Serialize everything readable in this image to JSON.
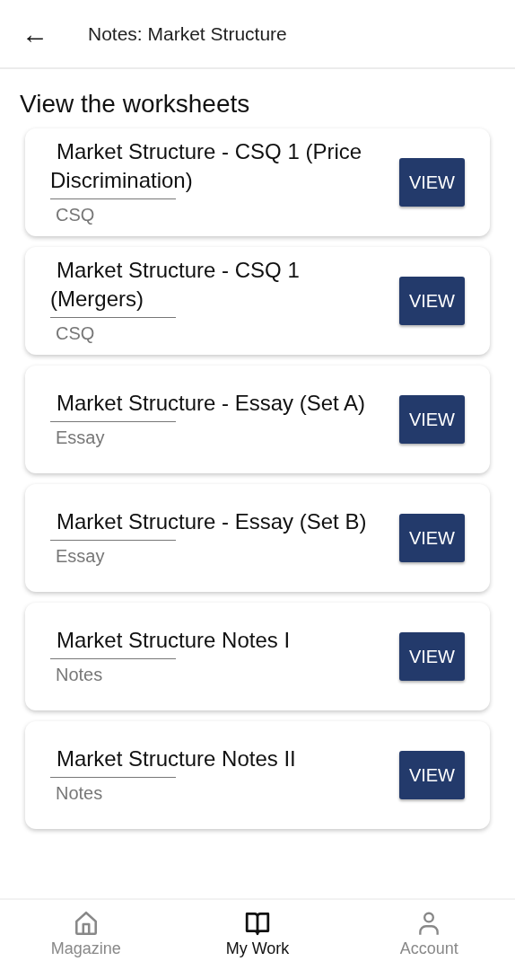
{
  "header": {
    "back": "←",
    "title": "Notes: Market Structure"
  },
  "heading": "View the worksheets",
  "worksheets": [
    {
      "title": "Market Structure - CSQ 1 (Price Discrimination)",
      "type": "CSQ",
      "button": "VIEW"
    },
    {
      "title": "Market Structure - CSQ 1 (Mergers)",
      "type": "CSQ",
      "button": "VIEW"
    },
    {
      "title": "Market Structure - Essay (Set A)",
      "type": "Essay",
      "button": "VIEW"
    },
    {
      "title": "Market Structure - Essay (Set B)",
      "type": "Essay",
      "button": "VIEW"
    },
    {
      "title": "Market Structure Notes I",
      "type": "Notes",
      "button": "VIEW"
    },
    {
      "title": "Market Structure Notes II",
      "type": "Notes",
      "button": "VIEW"
    }
  ],
  "bottom_nav": [
    {
      "label": "Magazine",
      "selected": false
    },
    {
      "label": "My Work",
      "selected": true
    },
    {
      "label": "Account",
      "selected": false
    }
  ]
}
